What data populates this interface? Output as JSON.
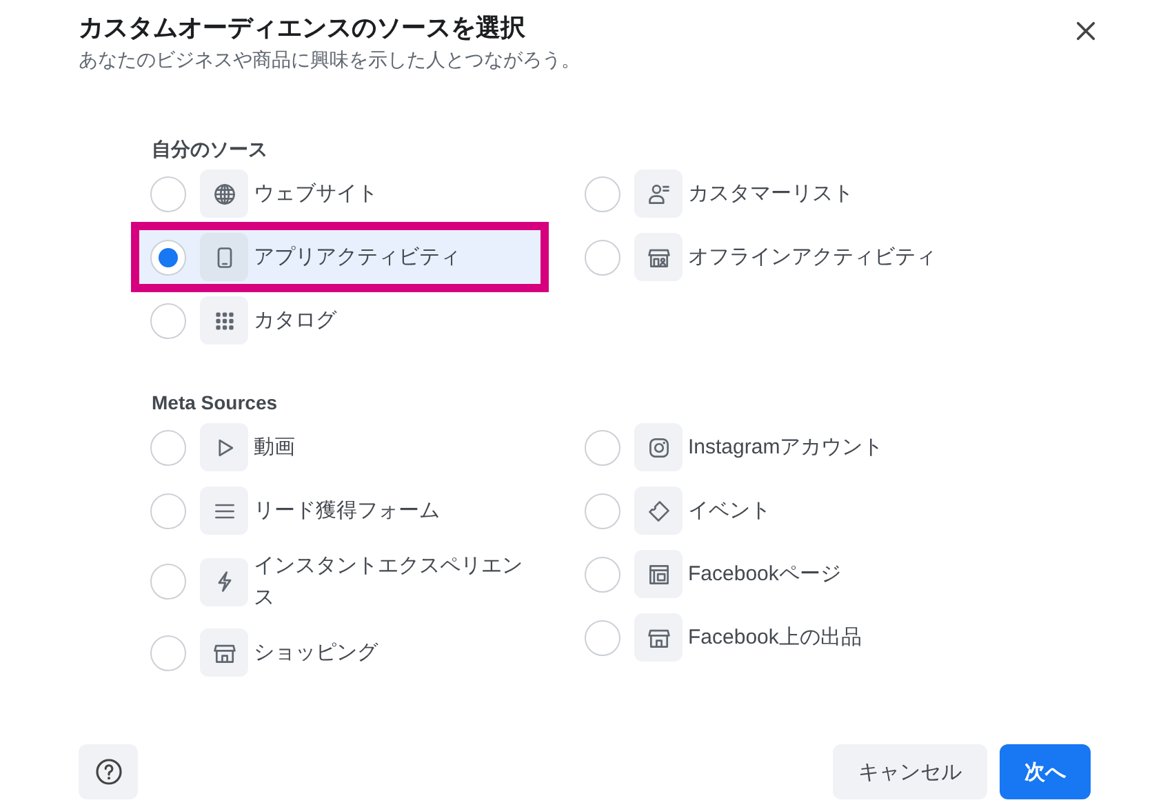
{
  "dialog": {
    "title": "カスタムオーディエンスのソースを選択",
    "subtitle": "あなたのビジネスや商品に興味を示した人とつながろう。"
  },
  "sections": [
    {
      "heading": "自分のソース",
      "columns": [
        [
          {
            "label": "ウェブサイト",
            "selected": false
          },
          {
            "label": "アプリアクティビティ",
            "selected": true
          },
          {
            "label": "カタログ",
            "selected": false
          }
        ],
        [
          {
            "label": "カスタマーリスト",
            "selected": false
          },
          {
            "label": "オフラインアクティビティ",
            "selected": false
          }
        ]
      ]
    },
    {
      "heading": "Meta Sources",
      "columns": [
        [
          {
            "label": "動画",
            "selected": false
          },
          {
            "label": "リード獲得フォーム",
            "selected": false
          },
          {
            "label": "インスタントエクスペリエンス",
            "selected": false
          },
          {
            "label": "ショッピング",
            "selected": false
          }
        ],
        [
          {
            "label": "Instagramアカウント",
            "selected": false
          },
          {
            "label": "イベント",
            "selected": false
          },
          {
            "label": "Facebookページ",
            "selected": false
          },
          {
            "label": "Facebook上の出品",
            "selected": false
          }
        ]
      ]
    }
  ],
  "footer": {
    "buttons": [
      {
        "label": "キャンセル",
        "kind": "secondary"
      },
      {
        "label": "次へ",
        "kind": "primary"
      }
    ]
  }
}
